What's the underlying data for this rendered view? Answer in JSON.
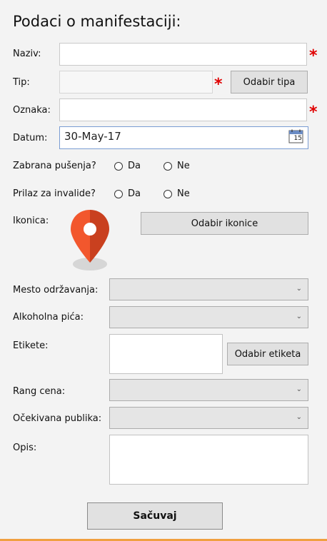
{
  "form": {
    "title": "Podaci o manifestaciji:",
    "required_mark": "*",
    "name_label": "Naziv:",
    "name_value": "",
    "type_label": "Tip:",
    "type_value": "",
    "type_button": "Odabir tipa",
    "tag_label": "Oznaka:",
    "tag_value": "",
    "date_label": "Datum:",
    "date_value": "30-May-17",
    "calendar_icon_text": "15",
    "smoking_label": "Zabrana pušenja?",
    "handicap_label": "Prilaz za invalide?",
    "yes_label": "Da",
    "no_label": "Ne",
    "icon_label": "Ikonica:",
    "icon_button": "Odabir ikonice",
    "location_label": "Mesto održavanja:",
    "location_value": "",
    "alcohol_label": "Alkoholna pića:",
    "alcohol_value": "",
    "labels_label": "Etikete:",
    "labels_button": "Odabir etiketa",
    "price_label": "Rang cena:",
    "price_value": "",
    "audience_label": "Očekivana publika:",
    "audience_value": "",
    "description_label": "Opis:",
    "description_value": "",
    "save_button": "Sačuvaj"
  },
  "icons": {
    "dropdown": "chevron-down-icon",
    "calendar": "calendar-icon",
    "marker": "map-marker-icon"
  },
  "colors": {
    "required": "#e00000",
    "marker_left": "#f2572d",
    "marker_right": "#c9401f",
    "accent_bottom": "#f0a040"
  }
}
